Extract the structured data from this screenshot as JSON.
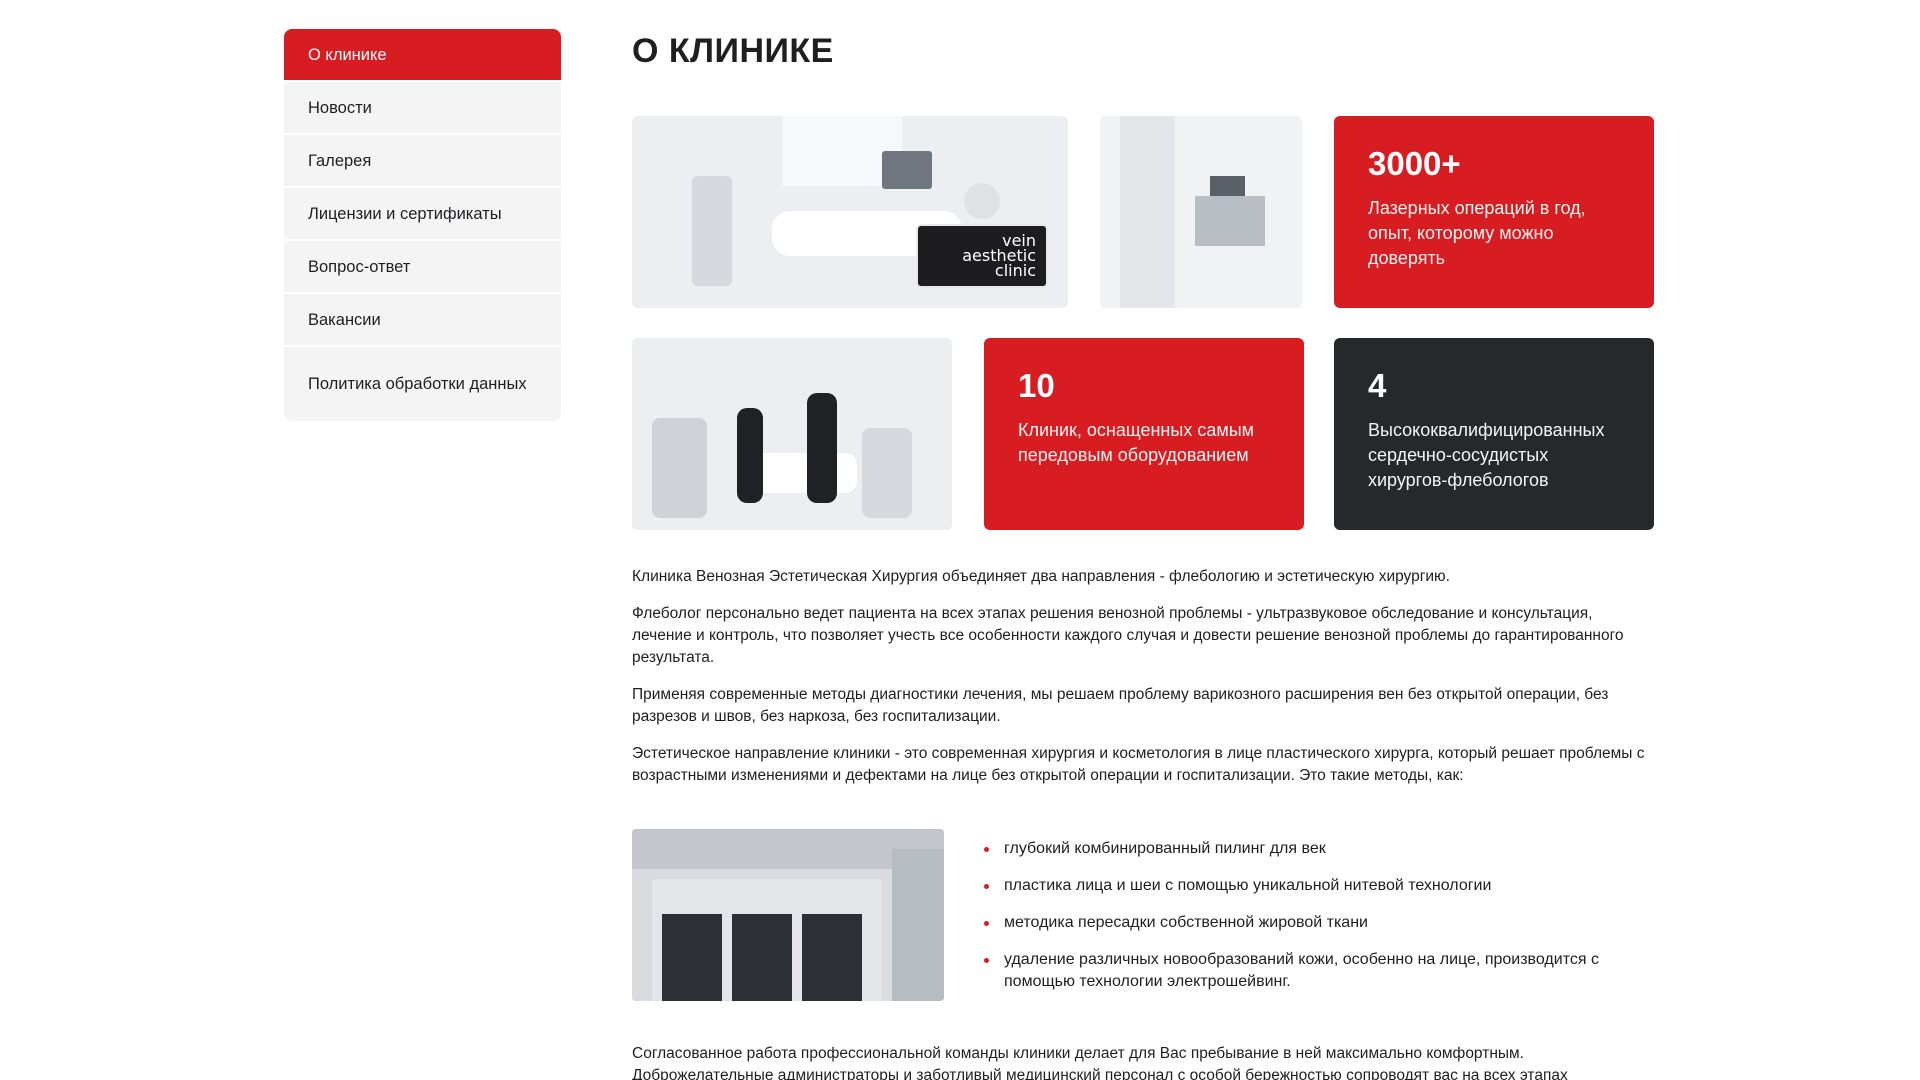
{
  "sidebar": {
    "items": [
      {
        "label": "О клинике",
        "active": true
      },
      {
        "label": "Новости"
      },
      {
        "label": "Галерея"
      },
      {
        "label": "Лицензии и сертификаты"
      },
      {
        "label": "Вопрос-ответ"
      },
      {
        "label": "Вакансии"
      },
      {
        "label": "Политика обработки данных"
      }
    ]
  },
  "main": {
    "title": "О КЛИНИКЕ",
    "logo": {
      "line1": "vein",
      "line2": "aesthetic",
      "line3": "clinic"
    },
    "stats": [
      {
        "number": "3000+",
        "text": "Лазерных операций в год, опыт, которому можно доверять"
      },
      {
        "number": "10",
        "text": "Клиник, оснащенных самым передовым оборудованием"
      },
      {
        "number": "4",
        "text": "Высококвалифицированных сердечно-сосудистых хирургов-флебологов"
      }
    ],
    "paragraphs": [
      "Клиника Венозная Эстетическая Хирургия объединяет два направления - флебологию и эстетическую хирургию.",
      "Флеболог персонально ведет пациента на всех этапах решения венозной проблемы - ультразвуковое обследование и консультация, лечение и контроль, что позволяет учесть все особенности каждого случая и довести решение венозной проблемы до гарантированного результата.",
      "Применяя современные методы диагностики лечения, мы решаем  проблему варикозного расширения вен без открытой операции, без разрезов и швов, без наркоза, без госпитализации.",
      "Эстетическое направление клиники - это современная хирургия и косметология в лице пластического хирурга, который решает проблемы с возрастными изменениями и дефектами на лице без открытой операции и госпитализации. Это такие методы, как:"
    ],
    "methods": [
      "глубокий комбинированный пилинг для век",
      "пластика лица и шеи с помощью уникальной нитевой технологии",
      "методика пересадки собственной жировой ткани",
      "удаление различных новообразований кожи, особенно на лице, производится с помощью технологии электрошейвинг."
    ],
    "footer_text": "Согласованное работа профессиональной команды клиники делает для Вас пребывание в ней максимально комфортным. Доброжелательные администраторы и заботливый медицинский персонал с особой бережностью сопроводят вас на всех этапах"
  },
  "colors": {
    "accent": "#d71c22",
    "dark": "#27282c",
    "sidebar_bg": "#f4f4f5"
  }
}
